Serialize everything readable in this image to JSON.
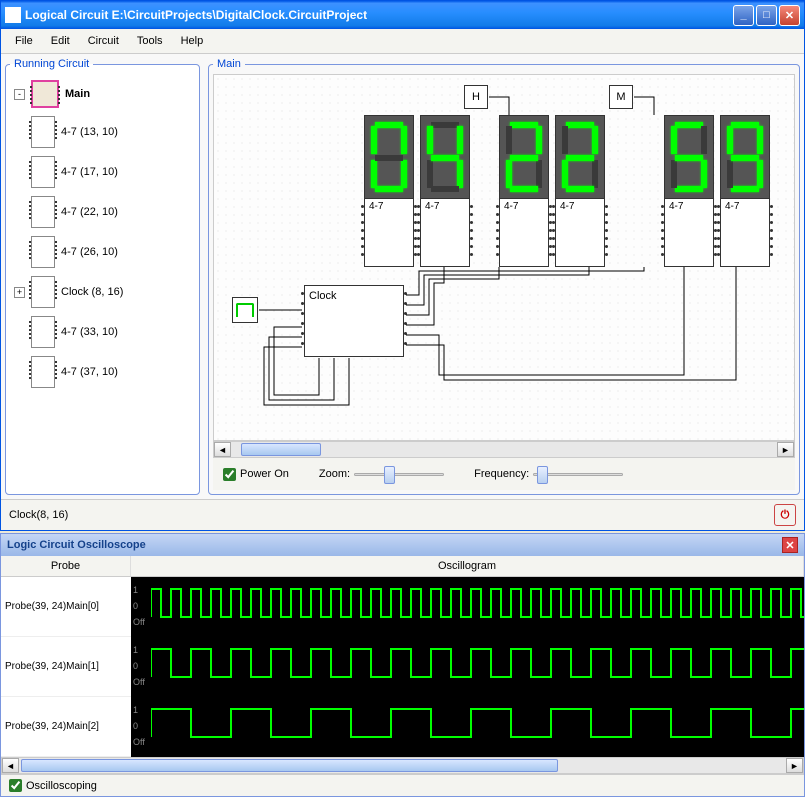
{
  "title": "Logical Circuit E:\\CircuitProjects\\DigitalClock.CircuitProject",
  "menu": {
    "file": "File",
    "edit": "Edit",
    "circuit": "Circuit",
    "tools": "Tools",
    "help": "Help"
  },
  "tree": {
    "legend": "Running Circuit",
    "items": [
      {
        "label": "Main",
        "main": true,
        "toggle": "-"
      },
      {
        "label": "4-7 (13, 10)"
      },
      {
        "label": "4-7 (17, 10)"
      },
      {
        "label": "4-7 (22, 10)"
      },
      {
        "label": "4-7 (26, 10)"
      },
      {
        "label": "Clock (8, 16)",
        "toggle": "+"
      },
      {
        "label": "4-7 (33, 10)"
      },
      {
        "label": "4-7 (37, 10)"
      }
    ]
  },
  "canvas": {
    "legend": "Main",
    "buttons": {
      "h": "H",
      "m": "M"
    },
    "clock_label": "Clock",
    "seg_label": "4-7",
    "digits": [
      "0",
      "4",
      "2",
      "2",
      "5",
      "9"
    ]
  },
  "controls": {
    "power": "Power On",
    "zoom": "Zoom:",
    "freq": "Frequency:"
  },
  "status": "Clock(8, 16)",
  "osc": {
    "title": "Logic Circuit Oscilloscope",
    "header_probe": "Probe",
    "header_gram": "Oscillogram",
    "probes": [
      "Probe(39, 24)Main[0]",
      "Probe(39, 24)Main[1]",
      "Probe(39, 24)Main[2]"
    ],
    "labels": [
      "1",
      "0",
      "Off"
    ],
    "checkbox": "Oscilloscoping"
  },
  "seg_map": {
    "0": [
      "a",
      "b",
      "c",
      "d",
      "e",
      "f"
    ],
    "1": [
      "b",
      "c"
    ],
    "2": [
      "a",
      "b",
      "g",
      "e",
      "d"
    ],
    "3": [
      "a",
      "b",
      "g",
      "c",
      "d"
    ],
    "4": [
      "f",
      "g",
      "b",
      "c"
    ],
    "5": [
      "a",
      "f",
      "g",
      "c",
      "d"
    ],
    "6": [
      "a",
      "f",
      "g",
      "e",
      "c",
      "d"
    ],
    "7": [
      "a",
      "b",
      "c"
    ],
    "8": [
      "a",
      "b",
      "c",
      "d",
      "e",
      "f",
      "g"
    ],
    "9": [
      "a",
      "b",
      "c",
      "d",
      "f",
      "g"
    ]
  }
}
